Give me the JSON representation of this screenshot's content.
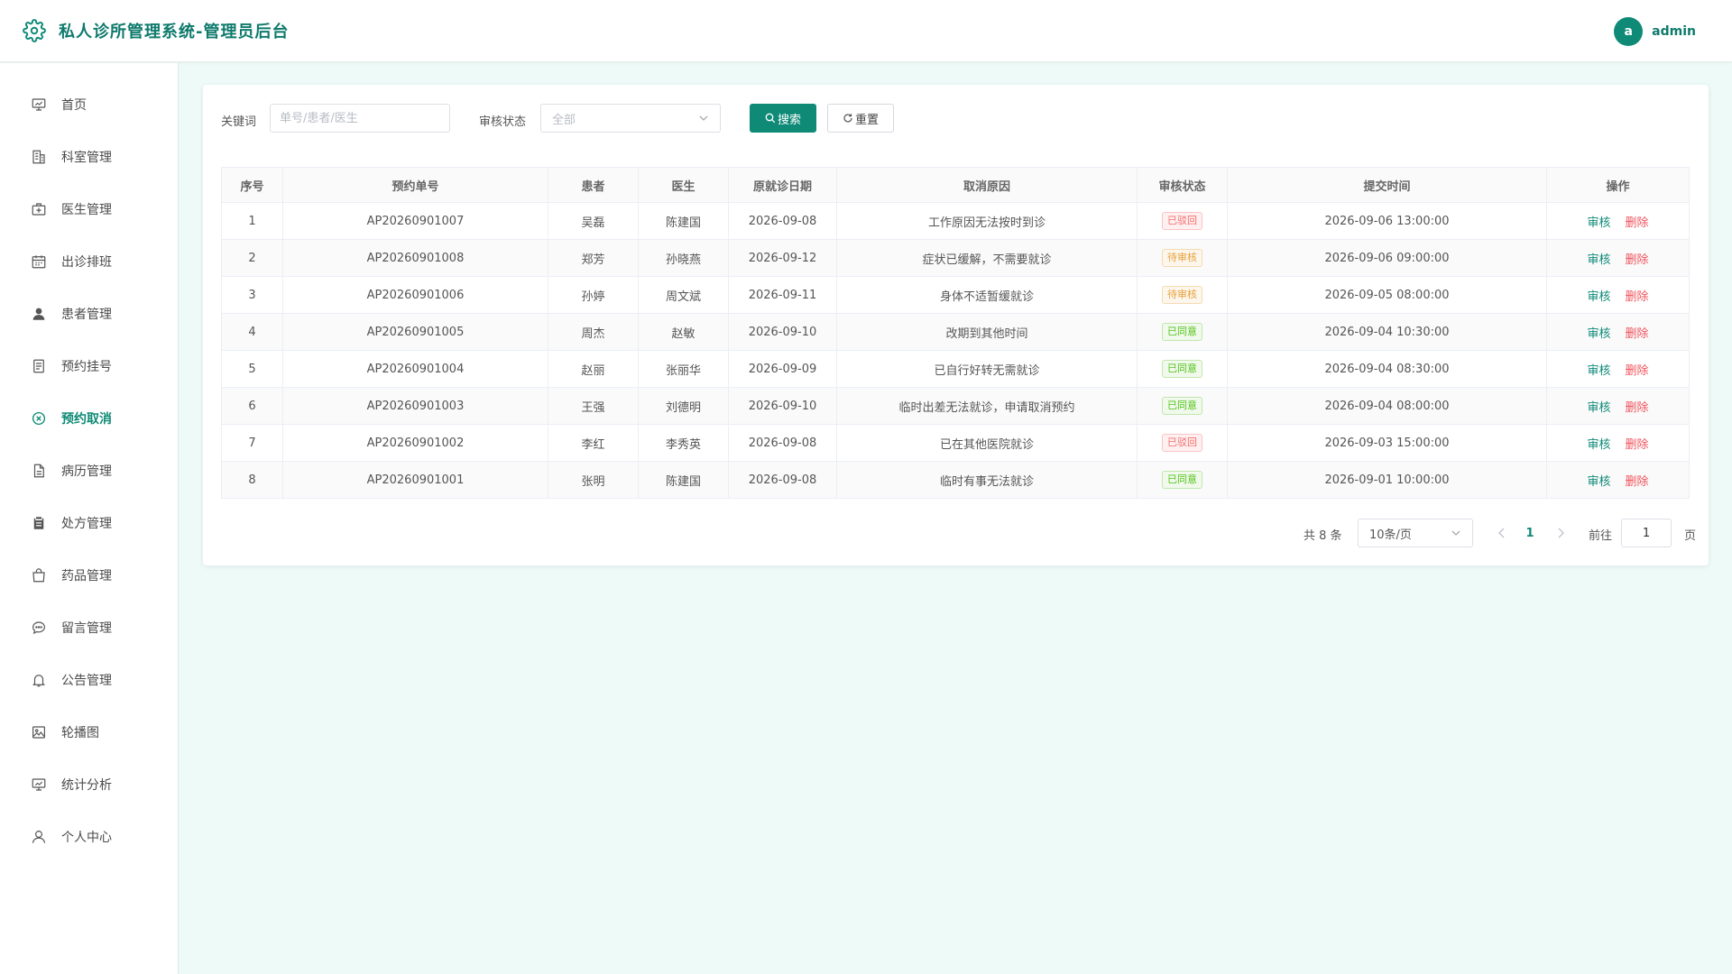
{
  "header": {
    "title": "私人诊所管理系统-管理员后台",
    "avatar_letter": "a",
    "username": "admin"
  },
  "sidebar": {
    "items": [
      {
        "label": "首页",
        "icon": "dashboard-icon"
      },
      {
        "label": "科室管理",
        "icon": "building-icon"
      },
      {
        "label": "医生管理",
        "icon": "medical-kit-icon"
      },
      {
        "label": "出诊排班",
        "icon": "calendar-icon"
      },
      {
        "label": "患者管理",
        "icon": "user-filled-icon"
      },
      {
        "label": "预约挂号",
        "icon": "document-icon"
      },
      {
        "label": "预约取消",
        "icon": "circle-close-icon",
        "active": true
      },
      {
        "label": "病历管理",
        "icon": "file-icon"
      },
      {
        "label": "处方管理",
        "icon": "clipboard-icon"
      },
      {
        "label": "药品管理",
        "icon": "bag-icon"
      },
      {
        "label": "留言管理",
        "icon": "chat-icon"
      },
      {
        "label": "公告管理",
        "icon": "bell-icon"
      },
      {
        "label": "轮播图",
        "icon": "picture-icon"
      },
      {
        "label": "统计分析",
        "icon": "chart-board-icon"
      },
      {
        "label": "个人中心",
        "icon": "user-icon"
      }
    ]
  },
  "filters": {
    "keyword_label": "关键词",
    "keyword_placeholder": "单号/患者/医生",
    "keyword_value": "",
    "status_label": "审核状态",
    "status_value": "全部",
    "search_label": "搜索",
    "reset_label": "重置"
  },
  "table": {
    "columns": [
      "序号",
      "预约单号",
      "患者",
      "医生",
      "原就诊日期",
      "取消原因",
      "审核状态",
      "提交时间",
      "操作"
    ],
    "rows": [
      {
        "no": "1",
        "order": "AP20260901007",
        "patient": "吴磊",
        "doctor": "陈建国",
        "date": "2026-09-08",
        "reason": "工作原因无法按时到诊",
        "status": "已驳回",
        "time": "2026-09-06 13:00:00"
      },
      {
        "no": "2",
        "order": "AP20260901008",
        "patient": "郑芳",
        "doctor": "孙晓燕",
        "date": "2026-09-12",
        "reason": "症状已缓解，不需要就诊",
        "status": "待审核",
        "time": "2026-09-06 09:00:00"
      },
      {
        "no": "3",
        "order": "AP20260901006",
        "patient": "孙婷",
        "doctor": "周文斌",
        "date": "2026-09-11",
        "reason": "身体不适暂缓就诊",
        "status": "待审核",
        "time": "2026-09-05 08:00:00"
      },
      {
        "no": "4",
        "order": "AP20260901005",
        "patient": "周杰",
        "doctor": "赵敏",
        "date": "2026-09-10",
        "reason": "改期到其他时间",
        "status": "已同意",
        "time": "2026-09-04 10:30:00"
      },
      {
        "no": "5",
        "order": "AP20260901004",
        "patient": "赵丽",
        "doctor": "张丽华",
        "date": "2026-09-09",
        "reason": "已自行好转无需就诊",
        "status": "已同意",
        "time": "2026-09-04 08:30:00"
      },
      {
        "no": "6",
        "order": "AP20260901003",
        "patient": "王强",
        "doctor": "刘德明",
        "date": "2026-09-10",
        "reason": "临时出差无法就诊，申请取消预约",
        "status": "已同意",
        "time": "2026-09-04 08:00:00"
      },
      {
        "no": "7",
        "order": "AP20260901002",
        "patient": "李红",
        "doctor": "李秀英",
        "date": "2026-09-08",
        "reason": "已在其他医院就诊",
        "status": "已驳回",
        "time": "2026-09-03 15:00:00"
      },
      {
        "no": "8",
        "order": "AP20260901001",
        "patient": "张明",
        "doctor": "陈建国",
        "date": "2026-09-08",
        "reason": "临时有事无法就诊",
        "status": "已同意",
        "time": "2026-09-01 10:00:00"
      }
    ],
    "action_audit": "审核",
    "action_delete": "删除"
  },
  "status_colors": {
    "已驳回": {
      "color": "#f56c6c",
      "bg": "#fef0f0",
      "border": "#fbc4c4"
    },
    "待审核": {
      "color": "#e6a23c",
      "bg": "#fdf6ec",
      "border": "#f5dab1"
    },
    "已同意": {
      "color": "#52c41a",
      "bg": "#f0f9eb",
      "border": "#c2e7b0"
    }
  },
  "pagination": {
    "total_text": "共 8 条",
    "page_size": "10条/页",
    "current_page": "1",
    "goto_label": "前往",
    "goto_value": "1",
    "page_suffix": "页"
  },
  "colors": {
    "primary": "#0e8a77",
    "danger": "#f0525b",
    "background": "#eefaf8"
  }
}
